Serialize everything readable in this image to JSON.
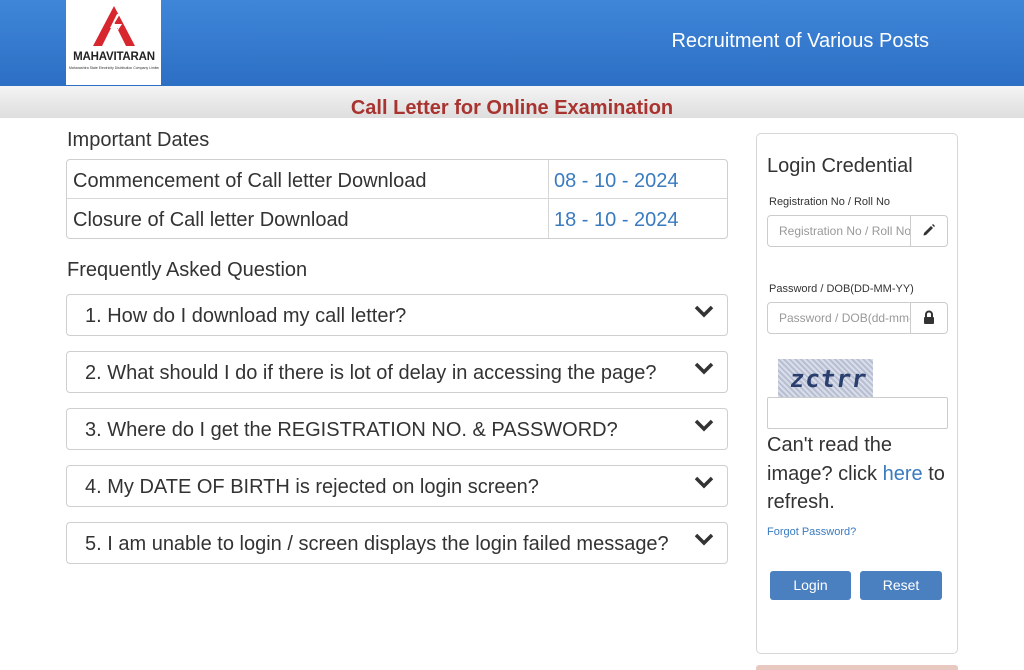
{
  "header": {
    "logo_name": "MAHAVITARAN",
    "logo_subtitle": "Maharashtra State Electricity Distribution Company Limited",
    "site_title": "Recruitment of Various Posts",
    "page_heading": "Call Letter for Online Examination",
    "brand_color": "#2c6fc4",
    "heading_color": "#a8332f"
  },
  "important_dates": {
    "heading": "Important Dates",
    "rows": [
      {
        "label": "Commencement of Call letter Download",
        "value": "08 - 10 - 2024"
      },
      {
        "label": "Closure of Call letter Download",
        "value": "18 - 10 - 2024"
      }
    ]
  },
  "faq": {
    "heading": "Frequently Asked Question",
    "items": [
      {
        "question": "1. How do I download my call letter?"
      },
      {
        "question": "2. What should I do if there is lot of delay in accessing the page?"
      },
      {
        "question": "3. Where do I get the REGISTRATION NO. & PASSWORD?"
      },
      {
        "question": "4. My DATE OF BIRTH is rejected on login screen?"
      },
      {
        "question": "5. I am unable to login / screen displays the login failed message?"
      }
    ],
    "icon": "chevron-down-icon"
  },
  "login": {
    "title": "Login Credential",
    "registration_label": "Registration No / Roll No",
    "registration_placeholder": "Registration No / Roll No",
    "registration_icon": "pencil-icon",
    "password_label": "Password / DOB(DD-MM-YY)",
    "password_placeholder": "Password / DOB(dd-mm-yy)",
    "password_icon": "lock-icon",
    "captcha_text": "zctrr",
    "refresh_prefix": "Can't read the image? click ",
    "refresh_link": "here",
    "refresh_suffix": " to refresh.",
    "forgot_password": "Forgot Password?",
    "login_button": "Login",
    "reset_button": "Reset",
    "button_color": "#4a7fc0"
  }
}
